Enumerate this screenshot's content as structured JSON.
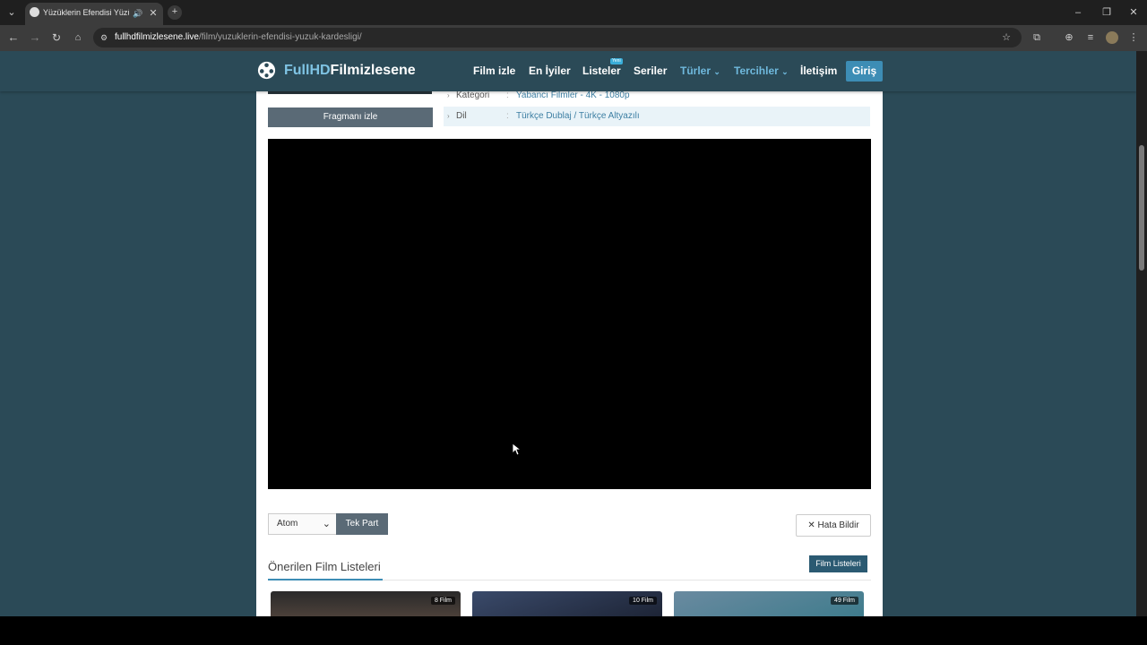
{
  "browser": {
    "tab_title": "Yüzüklerin Efendisi Yüzük K",
    "url_domain": "fullhdfilmizlesene.live",
    "url_path": "/film/yuzuklerin-efendisi-yuzuk-kardesligi/"
  },
  "site": {
    "logo_part1": "FullHD",
    "logo_part2": "Filmizlesene",
    "nav": {
      "film_izle": "Film izle",
      "en_iyiler": "En İyiler",
      "listeler": "Listeler",
      "listeler_badge": "Yeni",
      "seriler": "Seriler",
      "turler": "Türler",
      "tercihler": "Tercihler",
      "iletisim": "İletişim",
      "giris": "Giriş"
    }
  },
  "movie": {
    "trailer_button": "Fragmanı izle",
    "info": [
      {
        "label": "Kategori",
        "value": "Yabancı Filmler - 4K - 1080p"
      },
      {
        "label": "Dil",
        "value": "Türkçe Dublaj / Türkçe Altyazılı"
      }
    ]
  },
  "player_controls": {
    "source_selected": "Atom",
    "part_button": "Tek Part",
    "report_button": "Hata Bildir"
  },
  "lists": {
    "title": "Önerilen Film Listeleri",
    "button": "Film Listeleri",
    "items": [
      {
        "count": "8 Film"
      },
      {
        "count": "10 Film"
      },
      {
        "count": "49 Film"
      }
    ]
  }
}
